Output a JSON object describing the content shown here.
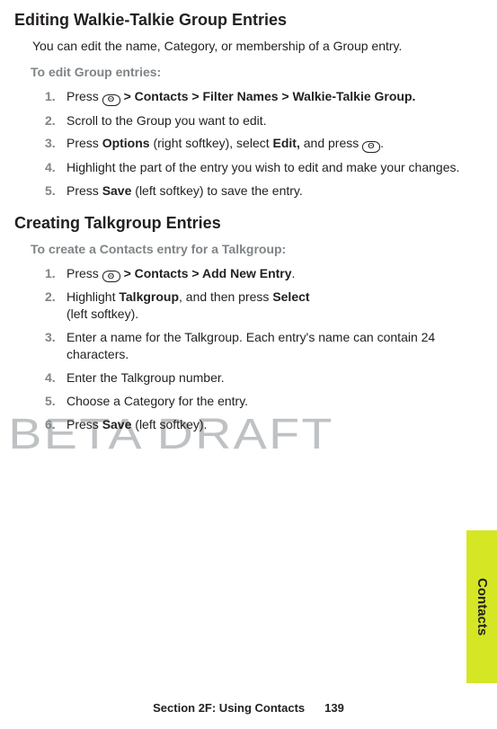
{
  "watermark": "BETA DRAFT",
  "side_tab": "Contacts",
  "footer": {
    "title": "Section 2F: Using Contacts",
    "page": "139"
  },
  "icon_glyph": "ⵙ",
  "s1": {
    "heading": "Editing Walkie-Talkie Group Entries",
    "intro": "You can edit the name, Category, or membership of a Group entry.",
    "subhead": "To edit Group entries:",
    "steps": {
      "n1": "1.",
      "t1a": "Press ",
      "t1b": " > Contacts > Filter Names > Walkie-Talkie Group.",
      "n2": "2.",
      "t2": "Scroll to the Group you want to edit.",
      "n3": "3.",
      "t3a": "Press ",
      "t3b": "Options",
      "t3c": " (right softkey), select ",
      "t3d": "Edit,",
      "t3e": " and press ",
      "t3f": ".",
      "n4": "4.",
      "t4": "Highlight the part of the entry you wish to edit and make your changes.",
      "n5": "5.",
      "t5a": "Press ",
      "t5b": "Save",
      "t5c": " (left softkey) to save the entry."
    }
  },
  "s2": {
    "heading": "Creating Talkgroup Entries",
    "subhead": "To create a Contacts entry for a Talkgroup:",
    "steps": {
      "n1": "1.",
      "t1a": "Press ",
      "t1b": " > Contacts > Add New Entry",
      "t1c": ".",
      "n2": "2.",
      "t2a": "Highlight ",
      "t2b": "Talkgroup",
      "t2c": ", and then press ",
      "t2d": "Select",
      "t2e": "(left softkey).",
      "n3": "3.",
      "t3": "Enter a name for the Talkgroup. Each entry's name can contain 24 characters.",
      "n4": "4.",
      "t4": "Enter the Talkgroup number.",
      "n5": "5.",
      "t5": "Choose a Category for the entry.",
      "n6": "6.",
      "t6a": "Press ",
      "t6b": "Save",
      "t6c": " (left softkey)."
    }
  }
}
